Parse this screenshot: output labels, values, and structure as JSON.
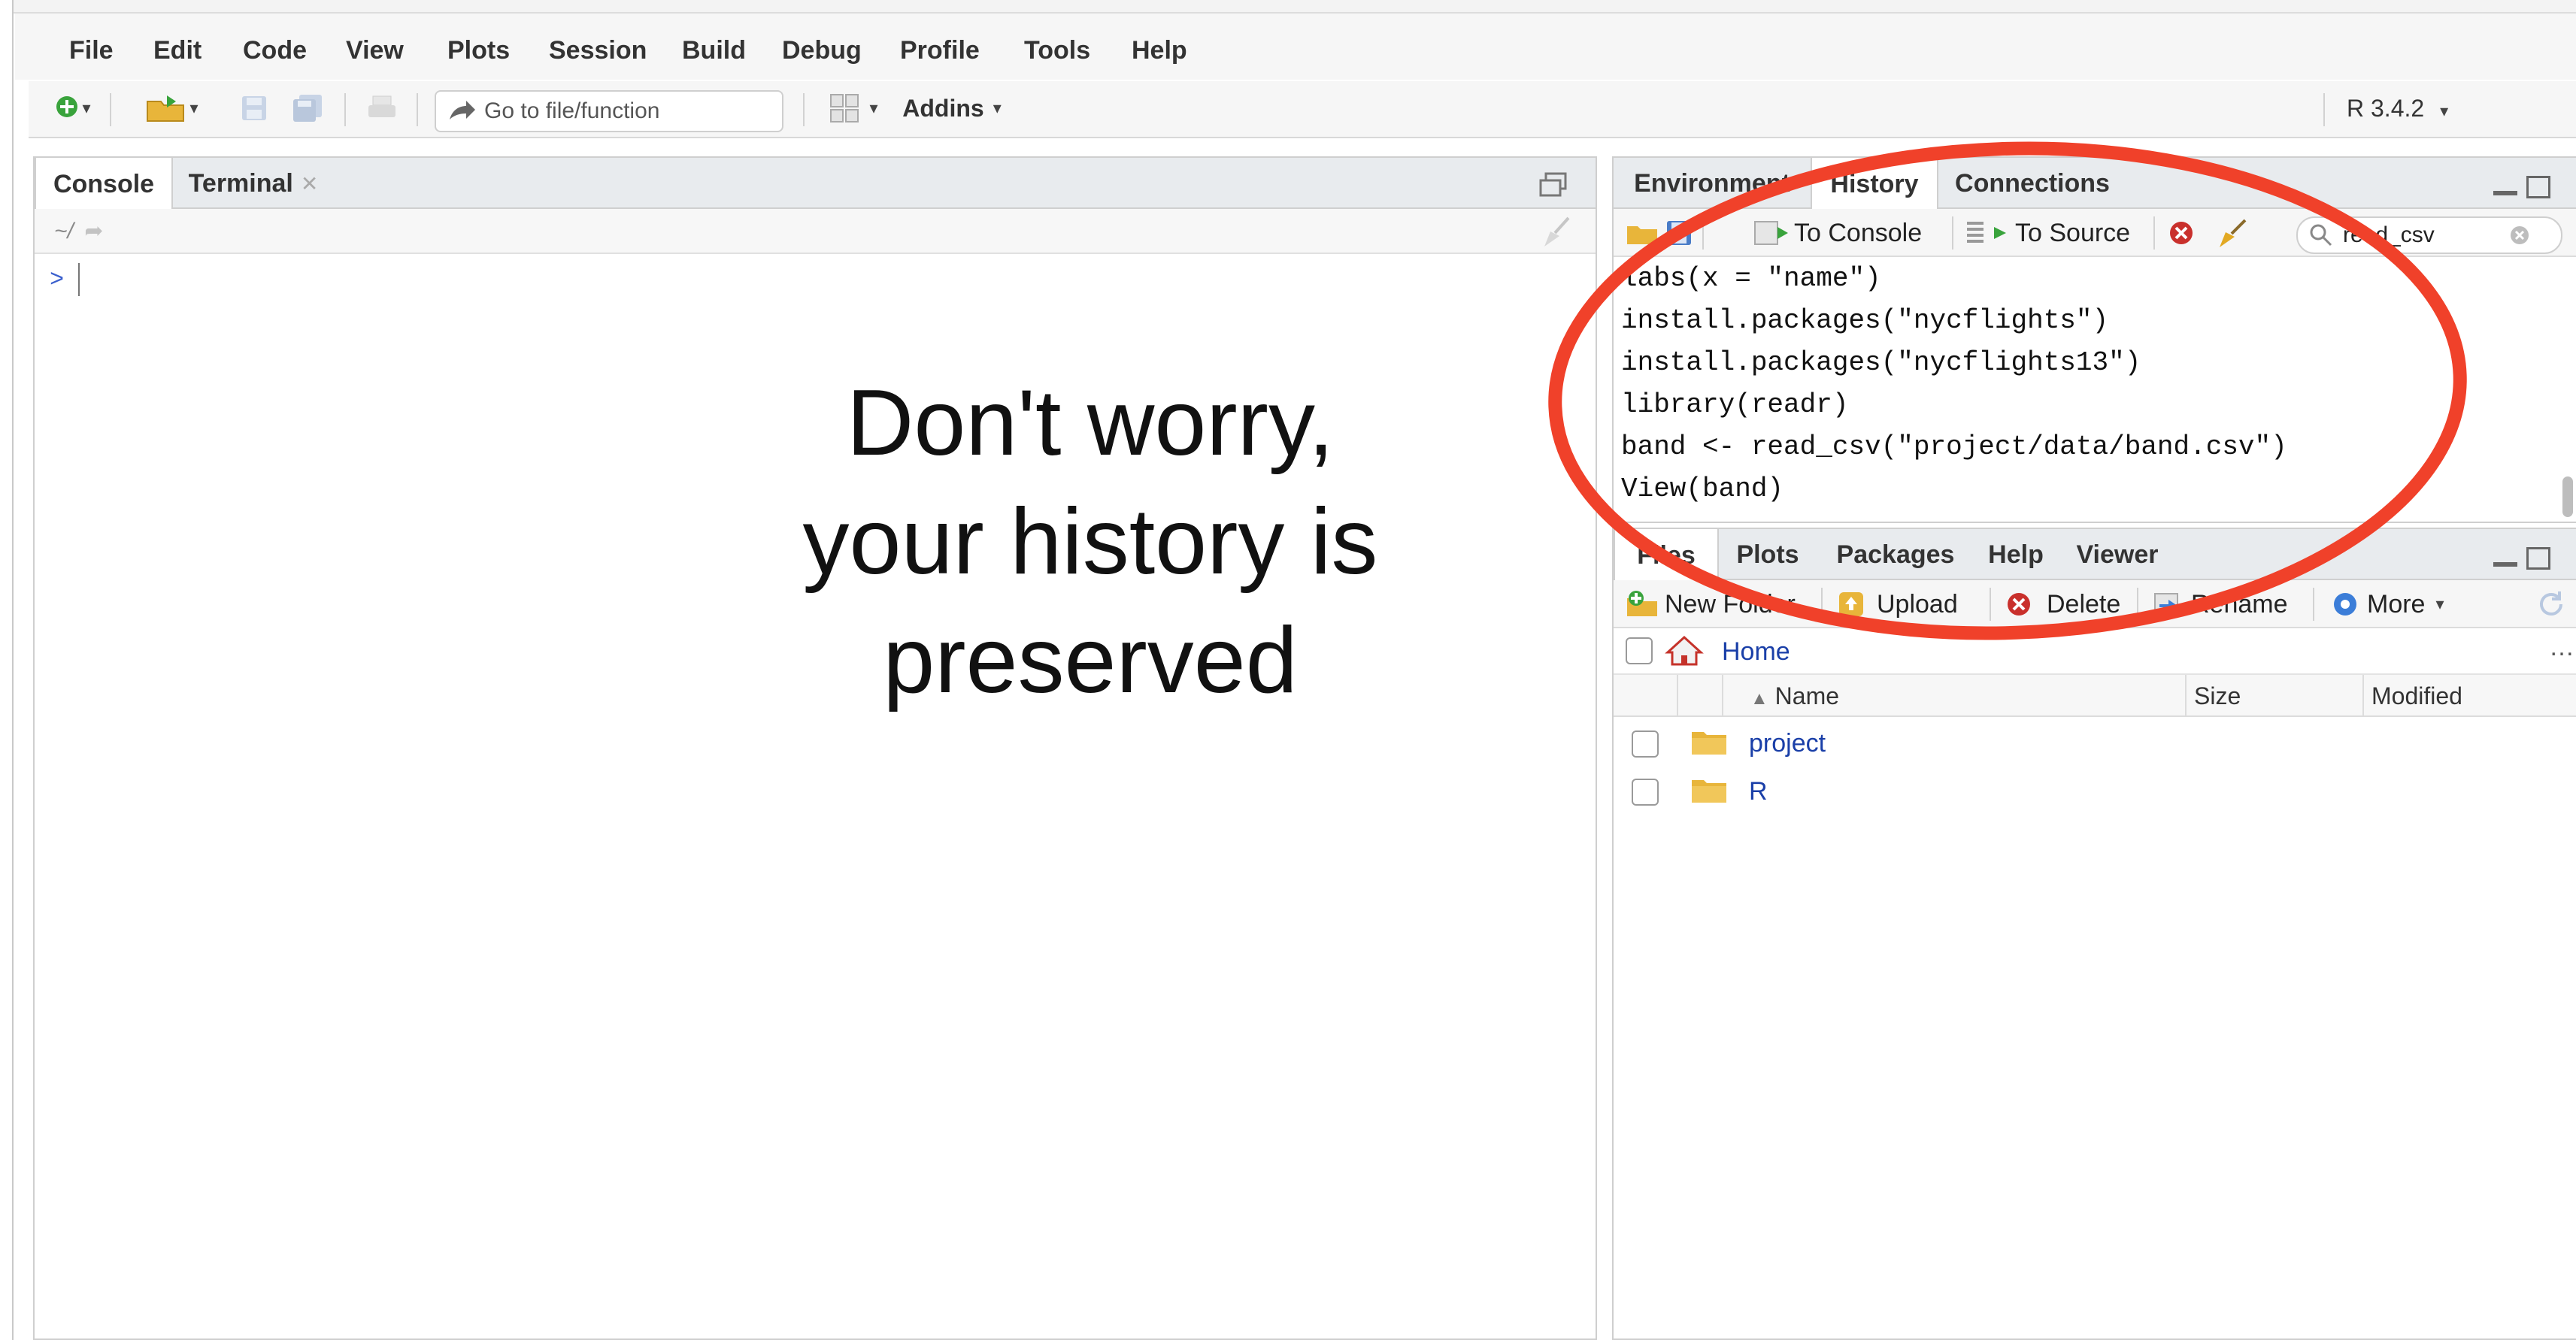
{
  "menubar": {
    "items": [
      "File",
      "Edit",
      "Code",
      "View",
      "Plots",
      "Session",
      "Build",
      "Debug",
      "Profile",
      "Tools",
      "Help"
    ]
  },
  "toolbar": {
    "goto_label": "Go to file/function",
    "addins_label": "Addins",
    "r_version": "R 3.4.2"
  },
  "left_pane": {
    "tabs": [
      {
        "label": "Console",
        "active": true
      },
      {
        "label": "Terminal",
        "active": false
      }
    ],
    "path": "~/",
    "prompt": ">"
  },
  "caption": {
    "lines": [
      "Don't worry,",
      "your history is",
      "preserved"
    ]
  },
  "top_right_pane": {
    "tabs": [
      {
        "label": "Environment",
        "active": false
      },
      {
        "label": "History",
        "active": true
      },
      {
        "label": "Connections",
        "active": false
      }
    ],
    "toolbar": {
      "to_console": "To Console",
      "to_source": "To Source"
    },
    "search": {
      "value": "read_csv"
    },
    "history_lines": [
      "labs(x = \"name\")",
      "install.packages(\"nycflights\")",
      "install.packages(\"nycflights13\")",
      "library(readr)",
      "band <- read_csv(\"project/data/band.csv\")",
      "View(band)"
    ]
  },
  "bottom_right_pane": {
    "tabs": [
      {
        "label": "Files",
        "active": true
      },
      {
        "label": "Plots",
        "active": false
      },
      {
        "label": "Packages",
        "active": false
      },
      {
        "label": "Help",
        "active": false
      },
      {
        "label": "Viewer",
        "active": false
      }
    ],
    "toolbar": {
      "new_folder": "New Folder",
      "upload": "Upload",
      "delete": "Delete",
      "rename": "Rename",
      "more": "More"
    },
    "breadcrumb": "Home",
    "columns": {
      "name": "Name",
      "size": "Size",
      "modified": "Modified"
    },
    "files": [
      {
        "name": "project"
      },
      {
        "name": "R"
      }
    ]
  },
  "colors": {
    "annotation": "#f0412a",
    "link": "#1a3fa8",
    "prompt": "#3a5fcd"
  }
}
